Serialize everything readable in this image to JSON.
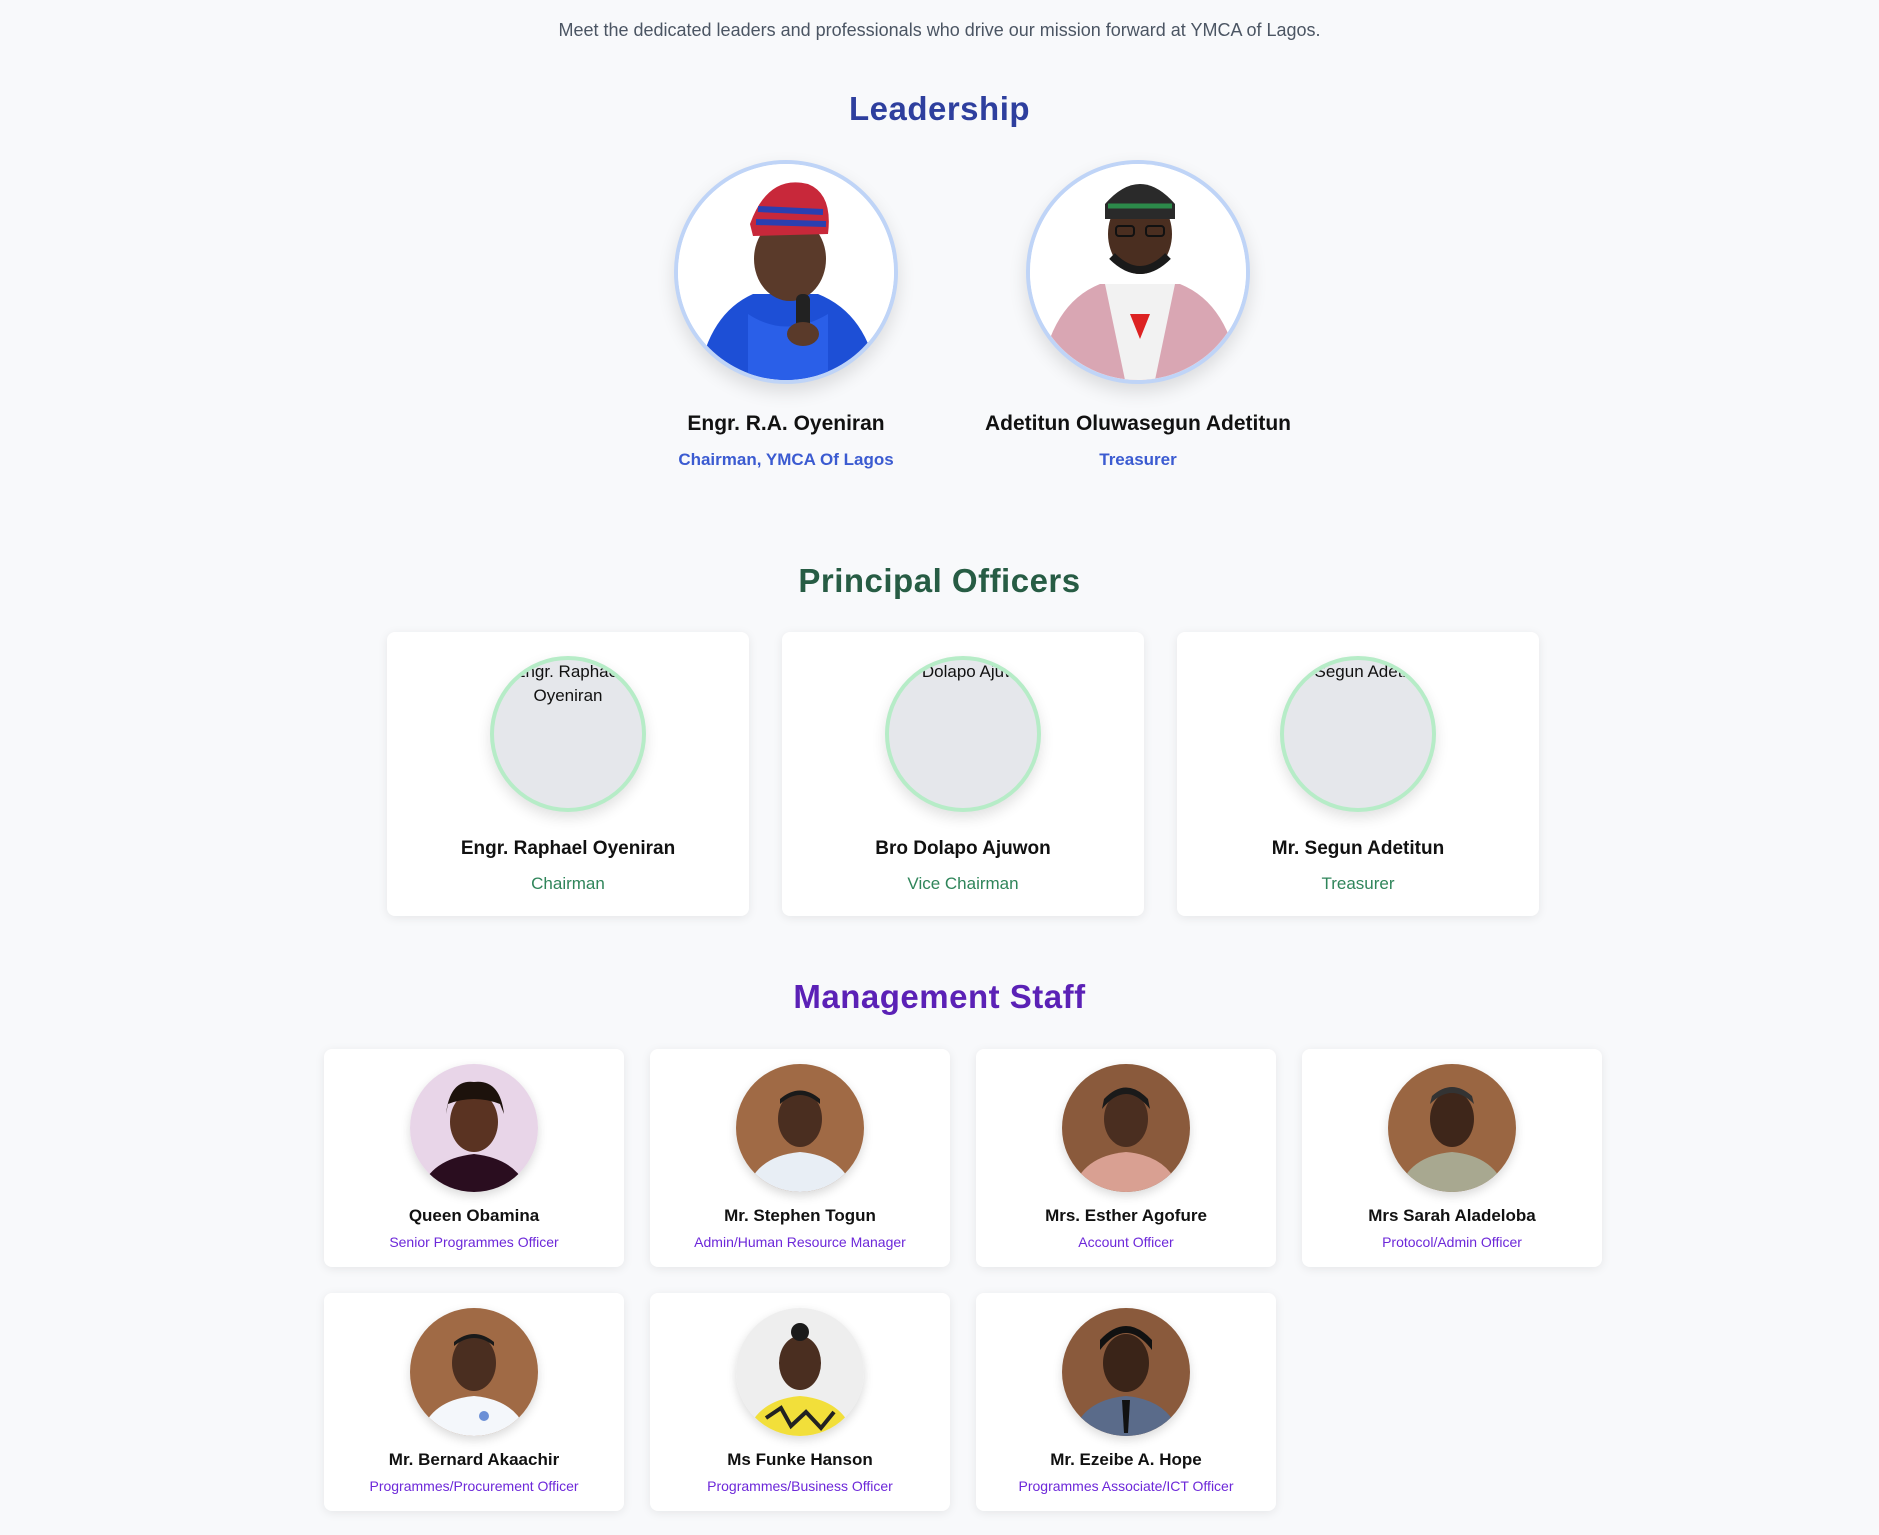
{
  "intro": "Meet the dedicated leaders and professionals who drive our mission forward at YMCA of Lagos.",
  "leadership": {
    "title": "Leadership",
    "members": [
      {
        "name": "Engr. R.A. Oyeniran",
        "role": "Chairman, YMCA Of Lagos"
      },
      {
        "name": "Adetitun Oluwasegun Adetitun",
        "role": "Treasurer"
      }
    ]
  },
  "principal": {
    "title": "Principal Officers",
    "members": [
      {
        "name": "Engr. Raphael Oyeniran",
        "role": "Chairman",
        "alt": "Engr. Raphael Oyeniran"
      },
      {
        "name": "Bro Dolapo Ajuwon",
        "role": "Vice Chairman",
        "alt": "Bro Dolapo Ajuwon"
      },
      {
        "name": "Mr. Segun Adetitun",
        "role": "Treasurer",
        "alt": "Mr. Segun Adetitun"
      }
    ]
  },
  "management": {
    "title": "Management Staff",
    "members": [
      {
        "name": "Queen Obamina",
        "role": "Senior Programmes Officer"
      },
      {
        "name": "Mr. Stephen Togun",
        "role": "Admin/Human Resource Manager"
      },
      {
        "name": "Mrs. Esther Agofure",
        "role": "Account Officer"
      },
      {
        "name": "Mrs Sarah Aladeloba",
        "role": "Protocol/Admin Officer"
      },
      {
        "name": "Mr. Bernard Akaachir",
        "role": "Programmes/Procurement Officer"
      },
      {
        "name": "Ms Funke Hanson",
        "role": "Programmes/Business Officer"
      },
      {
        "name": "Mr. Ezeibe A. Hope",
        "role": "Programmes Associate/ICT Officer"
      }
    ]
  },
  "colors": {
    "leadership_title": "#2e3f9e",
    "principal_title": "#275c44",
    "management_title": "#5b21b6",
    "leader_border": "#bfd4f7",
    "principal_border": "#b6ecc7"
  }
}
